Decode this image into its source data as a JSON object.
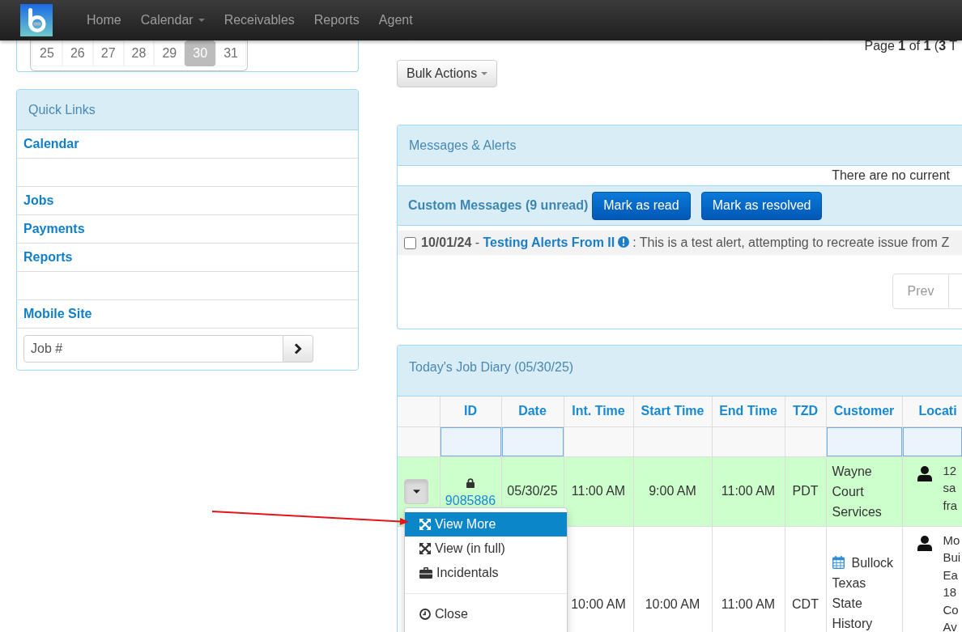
{
  "navbar": {
    "items": [
      {
        "label": "Home",
        "dropdown": false
      },
      {
        "label": "Calendar",
        "dropdown": true
      },
      {
        "label": "Receivables",
        "dropdown": false
      },
      {
        "label": "Reports",
        "dropdown": false
      },
      {
        "label": "Agent",
        "dropdown": false
      }
    ]
  },
  "mini_calendar": {
    "days": [
      {
        "label": "25",
        "selected": false
      },
      {
        "label": "26",
        "selected": false
      },
      {
        "label": "27",
        "selected": false
      },
      {
        "label": "28",
        "selected": false
      },
      {
        "label": "29",
        "selected": false
      },
      {
        "label": "30",
        "selected": true
      },
      {
        "label": "31",
        "selected": false
      }
    ]
  },
  "quick_links": {
    "title": "Quick Links",
    "items": [
      {
        "kind": "link",
        "label": "Calendar"
      },
      {
        "kind": "spacer"
      },
      {
        "kind": "link",
        "label": "Jobs"
      },
      {
        "kind": "link",
        "label": "Payments"
      },
      {
        "kind": "link",
        "label": "Reports"
      },
      {
        "kind": "spacer"
      },
      {
        "kind": "link",
        "label": "Mobile Site"
      }
    ],
    "job_search": {
      "placeholder": "Job #"
    }
  },
  "pager_summary": "Page **1** of **1** (**3** T",
  "bulk_actions": {
    "label": "Bulk Actions"
  },
  "messages": {
    "title": "Messages & Alerts",
    "notice": "There are no current",
    "custom": {
      "label": "Custom Messages (9 unread)",
      "buttons": [
        "Mark as read",
        "Mark as resolved"
      ]
    },
    "alerts": [
      {
        "checked": false,
        "date": "10/01/24",
        "separator": "-",
        "title": "Testing Alerts From II",
        "text": ": This is a test alert, attempting to recreate issue from Z"
      }
    ],
    "pagination": {
      "prev": "Prev"
    }
  },
  "job_diary": {
    "title": "Today's Job Diary (05/30/25)",
    "columns": [
      {
        "label": "ID",
        "filterable": true
      },
      {
        "label": "Date",
        "filterable": true
      },
      {
        "label": "Int. Time",
        "filterable": false
      },
      {
        "label": "Start Time",
        "filterable": false
      },
      {
        "label": "End Time",
        "filterable": false
      },
      {
        "label": "TZD",
        "filterable": false
      },
      {
        "label": "Customer",
        "filterable": true
      },
      {
        "label": "Locati",
        "filterable": true
      }
    ],
    "rows": [
      {
        "highlighted": true,
        "menu_open": true,
        "locked": true,
        "id": "9085886",
        "date": "05/30/25",
        "int_time": "11:00 AM",
        "start_time": "9:00 AM",
        "end_time": "11:00 AM",
        "tzd": "PDT",
        "calendar_linked": false,
        "customer": "Wayne Court Services",
        "location": [
          "12",
          "sa",
          "fra"
        ]
      },
      {
        "highlighted": false,
        "int_time": "10:00 AM",
        "start_time": "10:00 AM",
        "end_time": "11:00 AM",
        "tzd": "CDT",
        "calendar_linked": true,
        "customer": "Bullock Texas State History",
        "location": [
          "Mo",
          "Bui",
          "Ea",
          "18",
          "Co",
          "Av"
        ]
      }
    ],
    "row_menu": {
      "items": [
        {
          "kind": "item",
          "label": "View More",
          "selected": true
        },
        {
          "kind": "item",
          "label": "View (in full)",
          "selected": false
        },
        {
          "kind": "item",
          "label": "Incidentals",
          "selected": false
        },
        {
          "kind": "divider"
        },
        {
          "kind": "item",
          "label": "Close",
          "selected": false
        }
      ]
    }
  }
}
